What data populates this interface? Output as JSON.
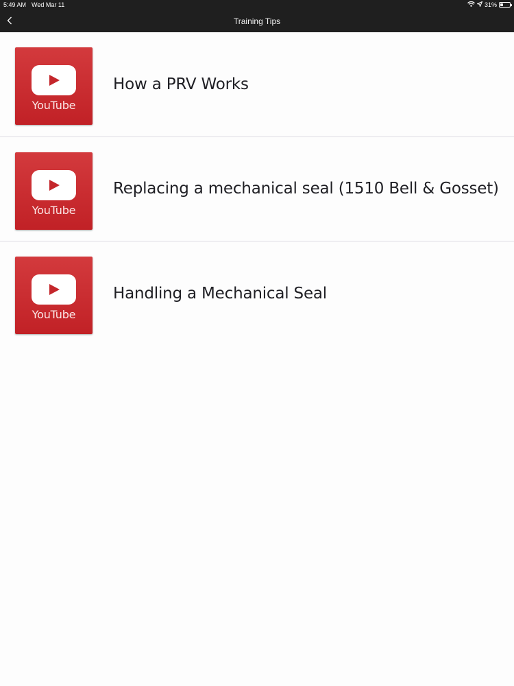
{
  "status_bar": {
    "time": "5:49 AM",
    "date": "Wed Mar 11",
    "battery_text": "31%",
    "battery_level": 0.31,
    "icons": [
      "wifi-icon",
      "location-icon",
      "battery-icon"
    ]
  },
  "nav": {
    "title": "Training Tips",
    "back_icon": "chevron-left-icon"
  },
  "videos": [
    {
      "title": "How a PRV Works",
      "thumb_label": "YouTube",
      "icon": "youtube-icon"
    },
    {
      "title": "Replacing a mechanical seal (1510 Bell & Gosset)",
      "thumb_label": "YouTube",
      "icon": "youtube-icon"
    },
    {
      "title": "Handling a Mechanical Seal",
      "thumb_label": "YouTube",
      "icon": "youtube-icon"
    }
  ],
  "colors": {
    "bar_background": "#1f1f1f",
    "thumbnail_red": "#c8262b",
    "divider": "#dedbe3",
    "title_text": "#1f1f24"
  }
}
